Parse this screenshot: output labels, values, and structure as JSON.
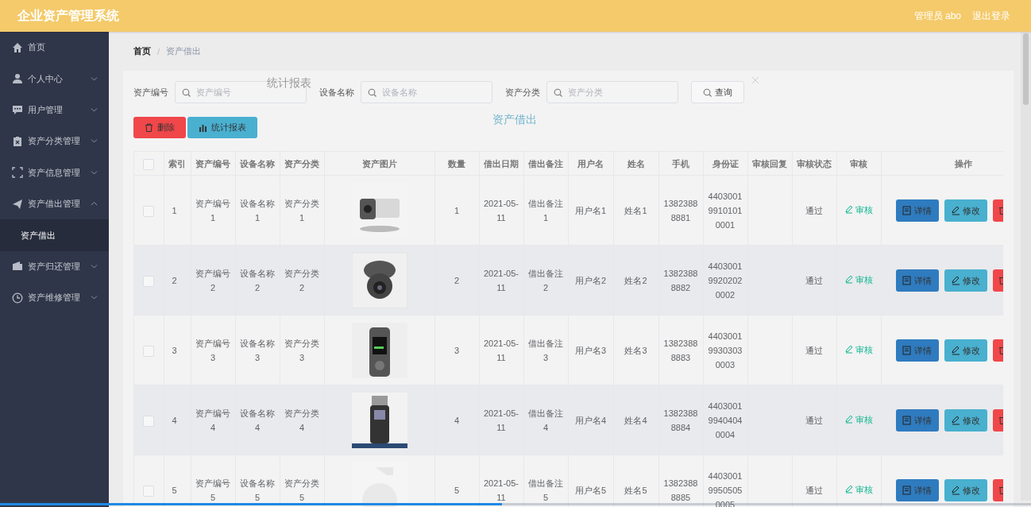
{
  "header": {
    "title": "企业资产管理系统",
    "user": "管理员 abo",
    "logout": "退出登录"
  },
  "sidebar": {
    "items": [
      {
        "label": "首页",
        "selected": false
      },
      {
        "label": "个人中心",
        "expanded": false,
        "selected": false
      },
      {
        "label": "用户管理",
        "expanded": false,
        "selected": false
      },
      {
        "label": "资产分类管理",
        "expanded": false,
        "selected": false
      },
      {
        "label": "资产信息管理",
        "expanded": false,
        "selected": false
      },
      {
        "label": "资产借出管理",
        "expanded": true,
        "selected": false,
        "children": [
          {
            "label": "资产借出",
            "selected": true
          }
        ]
      },
      {
        "label": "资产归还管理",
        "expanded": false,
        "selected": false
      },
      {
        "label": "资产维修管理",
        "expanded": false,
        "selected": false
      }
    ]
  },
  "breadcrumb": [
    "首页",
    "/",
    "资产借出"
  ],
  "search": [
    {
      "label": "资产编号",
      "placeholder": "资产编号"
    },
    {
      "label": "设备名称",
      "placeholder": "设备名称"
    },
    {
      "label": "资产分类",
      "placeholder": "资产分类"
    }
  ],
  "search_button": "查询",
  "toolbar": [
    {
      "label": "删除",
      "kind": "delete"
    },
    {
      "label": "统计报表",
      "kind": "report"
    }
  ],
  "table": {
    "header_checked": false,
    "columns": [
      "索引",
      "资产编号",
      "设备名称",
      "资产分类",
      "资产图片",
      "数量",
      "借出日期",
      "借出备注",
      "用户名",
      "姓名",
      "手机",
      "身份证",
      "审核回复",
      "审核状态",
      "审核",
      "操作"
    ],
    "rows": [
      {
        "checked": false,
        "cells": [
          "1",
          "资产编号1",
          "设备名称1",
          "资产分类1"
        ],
        "image": {
          "kind": "picture"
        },
        "more": [
          "1",
          "2021-05-11",
          "借出备注1",
          "用户名1",
          "姓名1",
          "13823888881",
          "440300199101010001"
        ],
        "status": "通过",
        "review": "审核",
        "actions": [
          {
            "label": "详情",
            "kind": "detail"
          },
          {
            "label": "修改",
            "kind": "edit"
          },
          {
            "kind": "delete"
          }
        ]
      },
      {
        "checked": false,
        "cells": [
          "2",
          "资产编号2",
          "设备名称2",
          "资产分类2"
        ],
        "image": {
          "kind": "picture"
        },
        "more": [
          "2",
          "2021-05-11",
          "借出备注2",
          "用户名2",
          "姓名2",
          "13823888882",
          "440300199202020002"
        ],
        "status": "通过",
        "review": "审核",
        "actions": [
          {
            "label": "详情",
            "kind": "detail"
          },
          {
            "label": "修改",
            "kind": "edit"
          },
          {
            "kind": "delete"
          }
        ]
      },
      {
        "checked": false,
        "cells": [
          "3",
          "资产编号3",
          "设备名称3",
          "资产分类3"
        ],
        "image": {
          "kind": "picture"
        },
        "more": [
          "3",
          "2021-05-11",
          "借出备注3",
          "用户名3",
          "姓名3",
          "13823888883",
          "440300199303030003"
        ],
        "status": "通过",
        "review": "审核",
        "actions": [
          {
            "label": "详情",
            "kind": "detail"
          },
          {
            "label": "修改",
            "kind": "edit"
          },
          {
            "kind": "delete"
          }
        ]
      },
      {
        "checked": false,
        "cells": [
          "4",
          "资产编号4",
          "设备名称4",
          "资产分类4"
        ],
        "image": {
          "kind": "picture"
        },
        "more": [
          "4",
          "2021-05-11",
          "借出备注4",
          "用户名4",
          "姓名4",
          "13823888884",
          "440300199404040004"
        ],
        "status": "通过",
        "review": "审核",
        "actions": [
          {
            "label": "详情",
            "kind": "detail"
          },
          {
            "label": "修改",
            "kind": "edit"
          },
          {
            "kind": "delete"
          }
        ]
      },
      {
        "checked": false,
        "cells": [
          "5",
          "资产编号5",
          "设备名称5",
          "资产分类5"
        ],
        "image": {
          "kind": "picture"
        },
        "more": [
          "5",
          "2021-05-11",
          "借出备注5",
          "用户名5",
          "姓名5",
          "13823888885",
          "440300199505050005"
        ],
        "status": "通过",
        "review": "审核",
        "actions": [
          {
            "label": "详情",
            "kind": "detail"
          },
          {
            "label": "修改",
            "kind": "edit"
          },
          {
            "kind": "delete"
          }
        ]
      }
    ]
  },
  "dialog": {
    "title": "统计报表",
    "chart_title": "资产借出"
  },
  "playback_bar": {
    "level": 0.487
  }
}
